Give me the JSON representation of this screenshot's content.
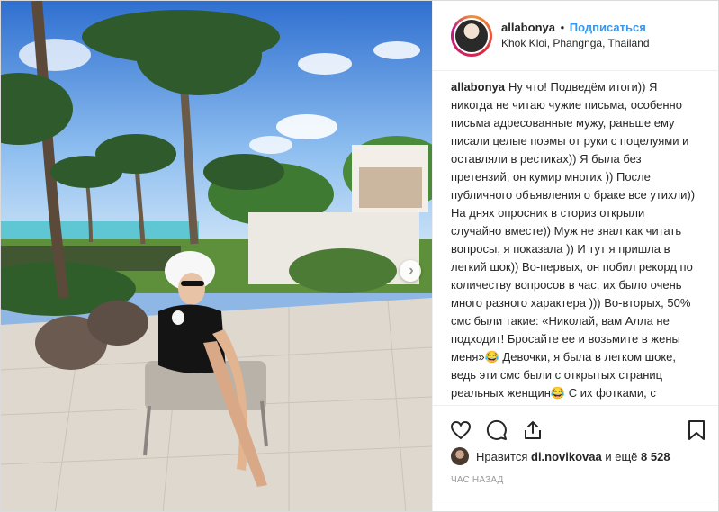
{
  "post": {
    "username": "allabonya",
    "follow_label": "Подписаться",
    "location": "Khok Kloi, Phangnga, Thailand",
    "separator": "•"
  },
  "caption": {
    "author": "allabonya",
    "text": "Ну что! Подведём итоги)) Я никогда не читаю чужие письма, особенно письма адресованные мужу, раньше ему писали целые поэмы от руки с поцелуями и оставляли в рестиках)) Я была без претензий, он кумир многих )) После публичного объявления о браке все утихли)) На днях опросник в сториз открыли случайно вместе)) Муж не знал как читать вопросы, я показала )) И тут я пришла в легкий шок)) Во-первых, он побил рекорд по количеству вопросов в час, их было очень много разного характера ))) Во-вторых, 50% смс были такие: «Николай, вам Алла не подходит! Бросайте ее и возьмите в жены меня»😂 Девочки, я была в легком шоке, ведь эти смс были с открытых страниц реальных женщин😂 С их фотками, с детьми и даже иногда с мужьями))) Первые угадали две"
  },
  "likes": {
    "prefix": "Нравится",
    "user": "di.novikovaa",
    "middle": "и ещё",
    "count": "8 528"
  },
  "timestamp": "час назад",
  "icons": {
    "like": "heart-icon",
    "comment": "comment-icon",
    "share": "share-icon",
    "save": "bookmark-icon",
    "next": "chevron-right-icon"
  },
  "colors": {
    "link": "#3897f0",
    "text": "#262626",
    "muted": "#999999",
    "border": "#efefef"
  }
}
